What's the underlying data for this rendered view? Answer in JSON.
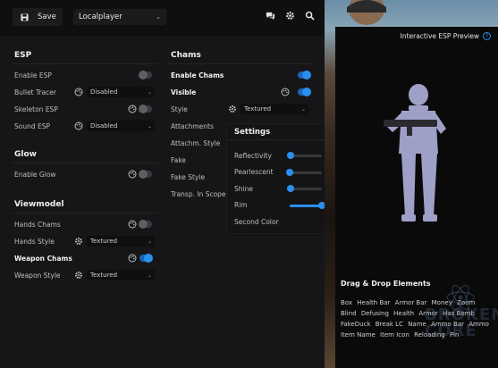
{
  "toolbar": {
    "save_label": "Save",
    "config_value": "Localplayer",
    "icons": [
      "chat-icon",
      "gear-icon",
      "search-icon"
    ]
  },
  "esp": {
    "title": "ESP",
    "items": [
      {
        "label": "Enable ESP",
        "enabled": false
      },
      {
        "label": "Bullet Tracer",
        "value": "Disabled"
      },
      {
        "label": "Skeleton ESP",
        "enabled": false
      },
      {
        "label": "Sound ESP",
        "value": "Disabled"
      }
    ]
  },
  "glow": {
    "title": "Glow",
    "items": [
      {
        "label": "Enable Glow",
        "enabled": false
      }
    ]
  },
  "viewmodel": {
    "title": "Viewmodel",
    "items": [
      {
        "label": "Hands Chams",
        "enabled": false
      },
      {
        "label": "Hands Style",
        "value": "Textured"
      },
      {
        "label": "Weapon Chams",
        "enabled": true
      },
      {
        "label": "Weapon Style",
        "value": "Textured"
      }
    ]
  },
  "chams": {
    "title": "Chams",
    "items": [
      {
        "label": "Enable Chams",
        "enabled": true
      },
      {
        "label": "Visible",
        "enabled": true
      },
      {
        "label": "Style",
        "value": "Textured"
      },
      {
        "label": "Attachments"
      },
      {
        "label": "Attachm. Style"
      },
      {
        "label": "Fake"
      },
      {
        "label": "Fake Style"
      },
      {
        "label": "Transp. In Scope"
      }
    ]
  },
  "settings": {
    "title": "Settings",
    "sliders": [
      {
        "label": "Reflectivity",
        "value": "2",
        "fraction": 0.02
      },
      {
        "label": "Pearlescent",
        "value": "0",
        "fraction": 0.0
      },
      {
        "label": "Shine",
        "value": "4",
        "fraction": 0.04
      },
      {
        "label": "Rim",
        "value": "100",
        "fraction": 1.0
      }
    ],
    "second_color_label": "Second Color"
  },
  "preview": {
    "title": "Interactive ESP Preview"
  },
  "drag_drop": {
    "title": "Drag & Drop Elements",
    "items": [
      "Box",
      "Health Bar",
      "Armor Bar",
      "Money",
      "Zoom",
      "Blind",
      "Defusing",
      "Health",
      "Armor",
      "Has Bomb",
      "FakeDuck",
      "Break LC",
      "Name",
      "Ammo Bar",
      "Ammo",
      "Item Name",
      "Item Icon",
      "Reloading",
      "Pin"
    ]
  },
  "watermark": {
    "line1": "BROKEN",
    "line2": "CORE"
  },
  "colors": {
    "accent": "#2b8ff0",
    "panel": "#161618",
    "background": "#0b0b0c"
  }
}
